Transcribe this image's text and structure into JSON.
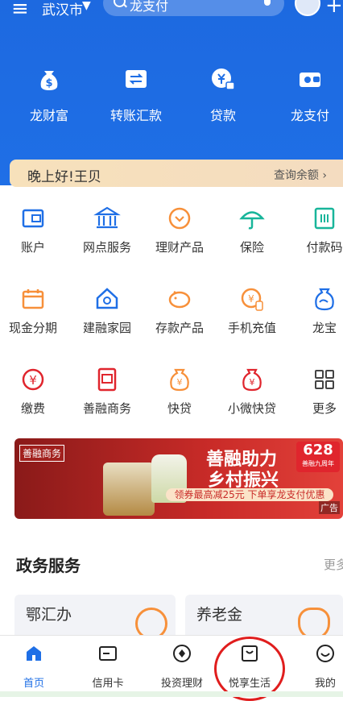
{
  "header": {
    "city": "武汉市",
    "search_placeholder": "龙支付"
  },
  "top_nav": [
    {
      "label": "龙财富",
      "icon": "money-bag-icon"
    },
    {
      "label": "转账汇款",
      "icon": "transfer-icon"
    },
    {
      "label": "贷款",
      "icon": "loan-icon"
    },
    {
      "label": "龙支付",
      "icon": "wallet-icon"
    }
  ],
  "greeting": {
    "text": "晚上好!王贝",
    "balance_link": "查询余额"
  },
  "grid": {
    "row1": [
      {
        "label": "账户",
        "icon": "account-icon"
      },
      {
        "label": "网点服务",
        "icon": "bank-branch-icon"
      },
      {
        "label": "理财产品",
        "icon": "financial-product-icon"
      },
      {
        "label": "保险",
        "icon": "umbrella-icon"
      },
      {
        "label": "付款码",
        "icon": "payment-code-icon"
      }
    ],
    "row2": [
      {
        "label": "现金分期",
        "icon": "calendar-icon"
      },
      {
        "label": "建融家园",
        "icon": "home-icon"
      },
      {
        "label": "存款产品",
        "icon": "piggy-bank-icon"
      },
      {
        "label": "手机充值",
        "icon": "phone-topup-icon"
      },
      {
        "label": "龙宝",
        "icon": "dragon-bag-icon"
      }
    ],
    "row3": [
      {
        "label": "缴费",
        "icon": "yuan-icon"
      },
      {
        "label": "善融商务",
        "icon": "shop-icon"
      },
      {
        "label": "快贷",
        "icon": "quick-loan-icon"
      },
      {
        "label": "小微快贷",
        "icon": "small-loan-icon"
      },
      {
        "label": "更多",
        "icon": "more-grid-icon"
      }
    ]
  },
  "banner": {
    "brand": "善融商务",
    "title1": "善融助力",
    "title2": "乡村振兴",
    "badge_num": "628",
    "badge_sub": "善融九周年",
    "coupon": "领券最高减25元 下单享龙支付优惠",
    "ad": "广告"
  },
  "section": {
    "title": "政务服务",
    "more": "更多"
  },
  "cards": [
    {
      "title": "鄂汇办"
    },
    {
      "title": "养老金"
    }
  ],
  "tabs": [
    {
      "label": "首页",
      "icon": "home-tab-icon",
      "active": true
    },
    {
      "label": "信用卡",
      "icon": "credit-card-icon"
    },
    {
      "label": "投资理财",
      "icon": "invest-icon"
    },
    {
      "label": "悦享生活",
      "icon": "life-bag-icon"
    },
    {
      "label": "我的",
      "icon": "profile-icon"
    }
  ],
  "colors": {
    "primary": "#1f6fe6",
    "accent_orange": "#f7903a",
    "accent_red": "#e0252d",
    "highlight_circle": "#e01d1d"
  }
}
